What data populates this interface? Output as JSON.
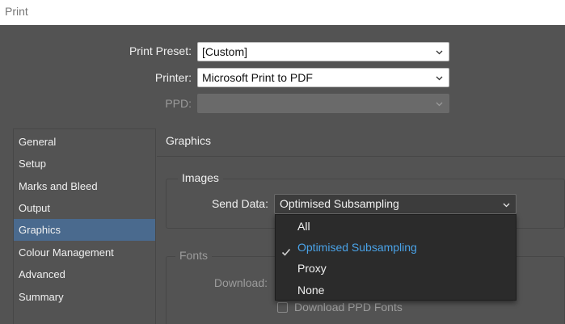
{
  "window": {
    "title": "Print"
  },
  "header": {
    "print_preset": {
      "label": "Print Preset:",
      "value": "[Custom]"
    },
    "printer": {
      "label": "Printer:",
      "value": "Microsoft Print to PDF"
    },
    "ppd": {
      "label": "PPD:",
      "value": ""
    }
  },
  "sidebar": {
    "items": [
      {
        "label": "General"
      },
      {
        "label": "Setup"
      },
      {
        "label": "Marks and Bleed"
      },
      {
        "label": "Output"
      },
      {
        "label": "Graphics",
        "active": true
      },
      {
        "label": "Colour Management"
      },
      {
        "label": "Advanced"
      },
      {
        "label": "Summary"
      }
    ]
  },
  "panel": {
    "title": "Graphics",
    "images": {
      "legend": "Images",
      "send_data": {
        "label": "Send Data:",
        "value": "Optimised Subsampling",
        "options": [
          "All",
          "Optimised Subsampling",
          "Proxy",
          "None"
        ],
        "selected_index": 1
      }
    },
    "fonts": {
      "legend": "Fonts",
      "download_label": "Download:",
      "download_ppd_fonts_label": "Download PPD Fonts",
      "download_ppd_fonts_checked": false
    }
  },
  "colors": {
    "background": "#535353",
    "accent_selected_text": "#4aa3e8",
    "sidebar_active": "#4a6a8e",
    "dropdown_bg": "#2b2b2b"
  },
  "icons": {
    "dropdown_arrow": "chevron-down-icon",
    "selected_mark": "checkmark-icon"
  }
}
